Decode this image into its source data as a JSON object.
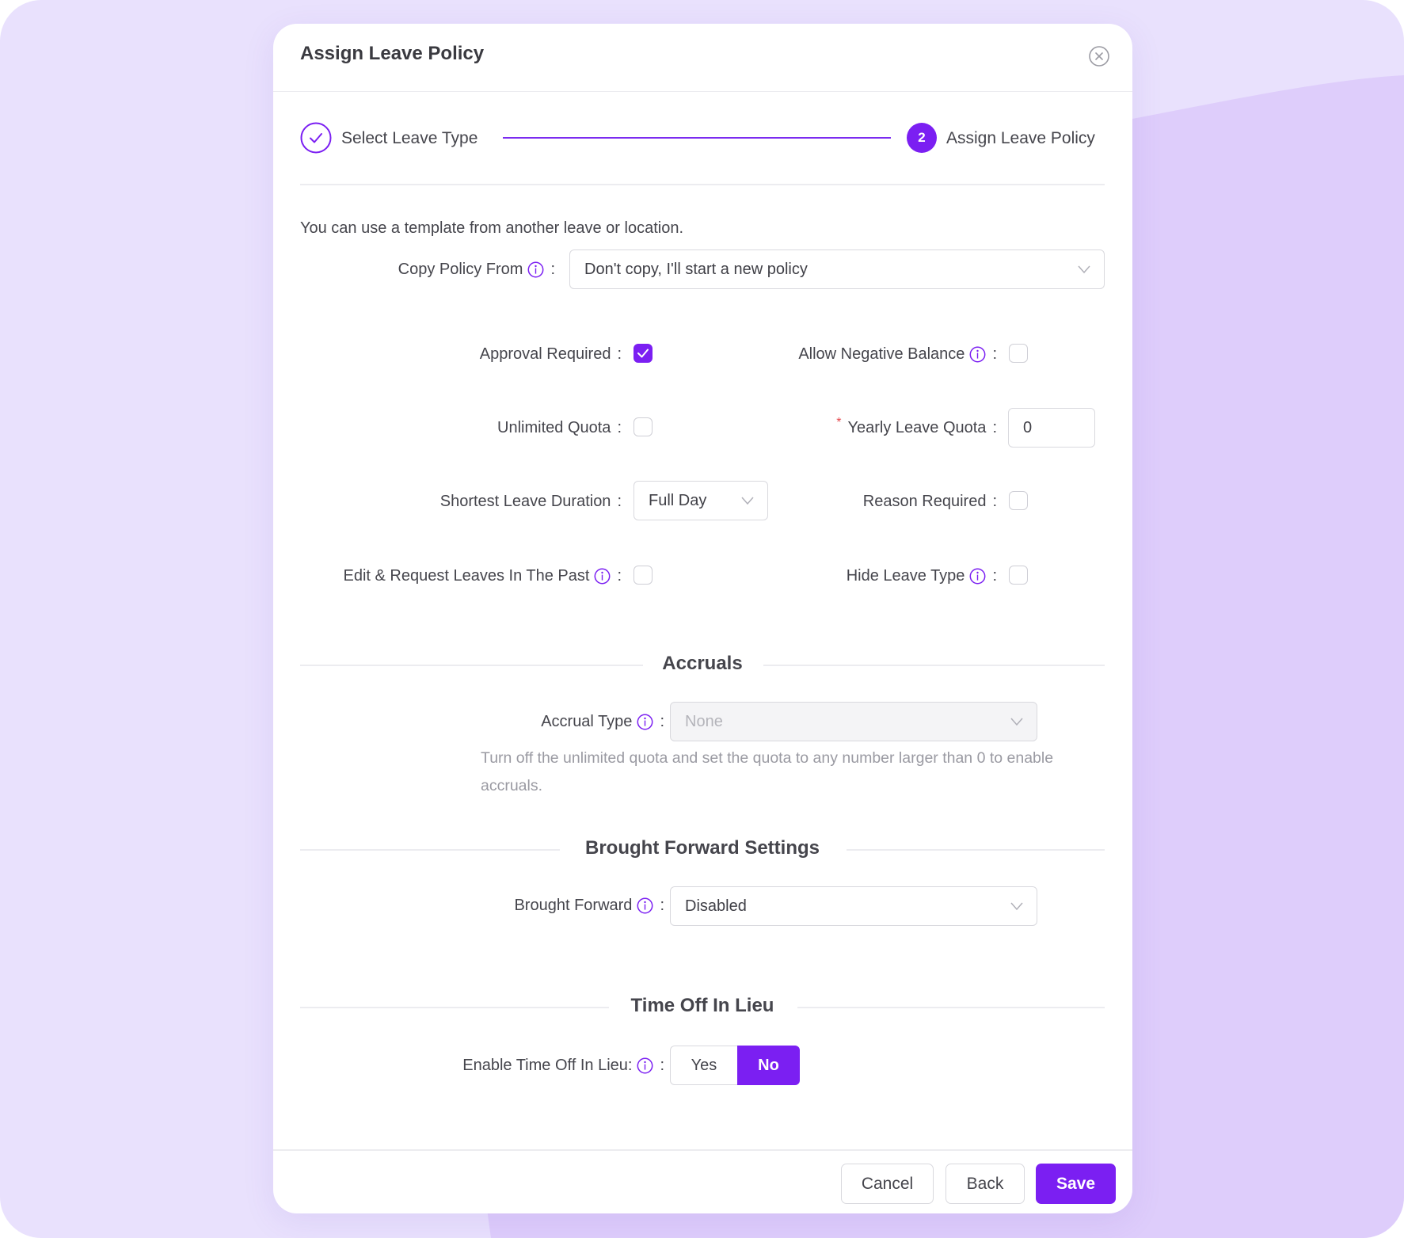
{
  "colors": {
    "accent": "#7B1FF2",
    "background_light": "#E9E1FD",
    "background_dark": "#DECDFB",
    "required_marker": "#E5484D"
  },
  "modal": {
    "title": "Assign Leave Policy",
    "close_icon": "close-circle-icon"
  },
  "steps": [
    {
      "label": "Select Leave Type",
      "status": "completed",
      "icon": "check-circle-icon"
    },
    {
      "label": "Assign Leave Policy",
      "status": "active",
      "number": "2"
    }
  ],
  "intro_text": "You can use a template from another leave or location.",
  "copy_policy": {
    "label": "Copy Policy From",
    "value": "Don't copy, I'll start a new policy"
  },
  "fields": {
    "approval_required": {
      "label": "Approval Required",
      "checked": true
    },
    "allow_negative_balance": {
      "label": "Allow Negative Balance",
      "checked": false
    },
    "unlimited_quota": {
      "label": "Unlimited Quota",
      "checked": false
    },
    "yearly_leave_quota": {
      "label": "Yearly Leave Quota",
      "value": "0",
      "required": true
    },
    "shortest_leave_duration": {
      "label": "Shortest Leave Duration",
      "value": "Full Day"
    },
    "reason_required": {
      "label": "Reason Required",
      "checked": false
    },
    "edit_request_past": {
      "label": "Edit & Request Leaves In The Past",
      "checked": false
    },
    "hide_leave_type": {
      "label": "Hide Leave Type",
      "checked": false
    }
  },
  "colon": ":",
  "required_marker": "*",
  "accruals": {
    "heading": "Accruals",
    "accrual_type_label": "Accrual Type",
    "accrual_type_value": "None",
    "help_text": "Turn off the unlimited quota and set the quota to any number larger than 0 to enable accruals."
  },
  "brought_forward": {
    "heading": "Brought Forward Settings",
    "label": "Brought Forward",
    "value": "Disabled"
  },
  "toil": {
    "heading": "Time Off In Lieu",
    "label": "Enable Time Off In Lieu:",
    "options": [
      "Yes",
      "No"
    ],
    "selected": "No"
  },
  "footer": {
    "cancel": "Cancel",
    "back": "Back",
    "save": "Save"
  }
}
